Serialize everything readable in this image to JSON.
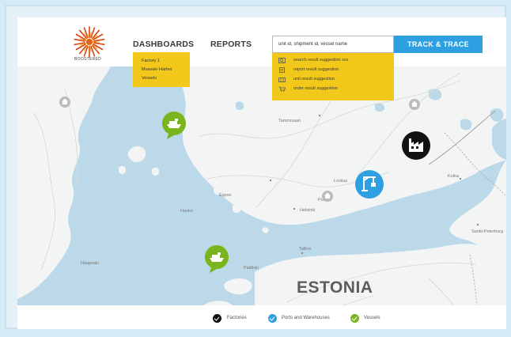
{
  "brand": {
    "name": "BOOSTERED"
  },
  "nav": {
    "dashboards": "DASHBOARDS",
    "reports": "REPORTS"
  },
  "dashboards_menu": [
    "Factory 1",
    "Mussalo Harbor",
    "Vessels"
  ],
  "search": {
    "value": "unit id, shipment id, vessel name",
    "button": "TRACK & TRACE",
    "suggestions": [
      "search result suggestion xxx",
      "report result suggestion",
      "unit result suggestion",
      "order result suggestion"
    ]
  },
  "map": {
    "country_label": "ESTONIA",
    "places": [
      "Tammisaari",
      "Espoo",
      "Kotka",
      "Porvoo",
      "Loviisa",
      "Tallinn",
      "Helsinki",
      "Hanko",
      "Paldiski",
      "Sankt-Peterburg",
      "Haapsalu"
    ],
    "markers": [
      "vessel",
      "vessel",
      "factory",
      "port"
    ]
  },
  "legend": [
    {
      "label": "Factories",
      "color": "#111111"
    },
    {
      "label": "Ports and Warehouses",
      "color": "#2e9fe0"
    },
    {
      "label": "Vessels",
      "color": "#7ab51d"
    }
  ],
  "colors": {
    "accent": "#2e9fe0",
    "highlight": "#f2c91a",
    "vessel": "#7ab51d",
    "water": "#bcd9ea",
    "land": "#f3f5f5"
  }
}
